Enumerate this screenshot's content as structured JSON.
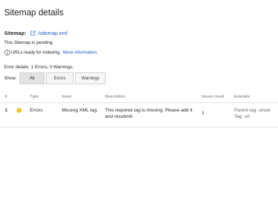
{
  "header": {
    "title": "Sitemap details"
  },
  "sitemap": {
    "label": "Sitemap:",
    "path": "/sitemap.xml"
  },
  "status": {
    "pending": "This Sitemap is pending.",
    "urls_text": "URLs ready for indexing.",
    "more_info": "More information."
  },
  "errors": {
    "details": "Error details: 1 Errors, 0 Warnings."
  },
  "filter": {
    "label": "Show:",
    "buttons": [
      "All",
      "Errors",
      "Warnings"
    ],
    "selected": "All"
  },
  "table": {
    "headers": [
      "#",
      "Type",
      "Issue",
      "Description",
      "Issues count",
      "Example"
    ],
    "rows": [
      {
        "num": "1",
        "type": "Errors",
        "issue": "Missing XML tag",
        "description": "This required tag is missing. Please add it and resubmit.",
        "count": "1",
        "example_parent": "Parent tag: urlset",
        "example_tag": "Tag: url"
      }
    ]
  },
  "colors": {
    "link": "#1a57c6",
    "warning": "#f4b400"
  },
  "icons": {
    "external": "external-link-icon",
    "info": "info-icon",
    "warning": "warning-icon"
  }
}
